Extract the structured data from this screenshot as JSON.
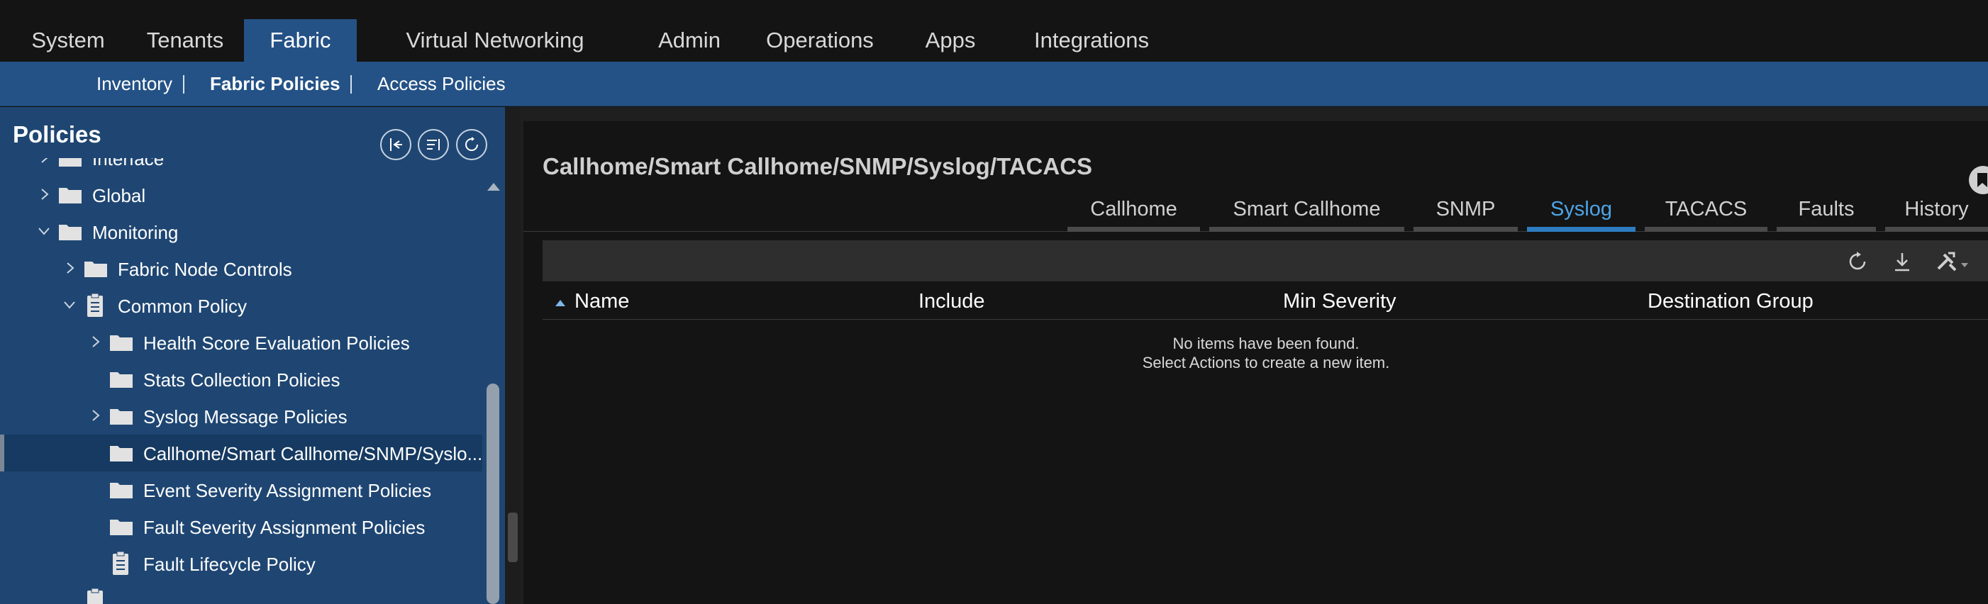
{
  "topnav": {
    "tabs": [
      "System",
      "Tenants",
      "Fabric",
      "Virtual Networking",
      "Admin",
      "Operations",
      "Apps",
      "Integrations"
    ],
    "active": "Fabric"
  },
  "subnav": {
    "items": [
      "Inventory",
      "Fabric Policies",
      "Access Policies"
    ],
    "active": "Fabric Policies"
  },
  "sidebar": {
    "title": "Policies",
    "tree": [
      {
        "label": "Interface",
        "icon": "folder-icon",
        "chevron": "right"
      },
      {
        "label": "Global",
        "icon": "folder-icon",
        "chevron": "right"
      },
      {
        "label": "Monitoring",
        "icon": "folder-icon",
        "chevron": "down"
      },
      {
        "label": "Fabric Node Controls",
        "icon": "folder-icon",
        "chevron": "right"
      },
      {
        "label": "Common Policy",
        "icon": "document-icon",
        "chevron": "down"
      },
      {
        "label": "Health Score Evaluation Policies",
        "icon": "folder-icon",
        "chevron": "right"
      },
      {
        "label": "Stats Collection Policies",
        "icon": "folder-icon",
        "chevron": "none"
      },
      {
        "label": "Syslog Message Policies",
        "icon": "folder-icon",
        "chevron": "right"
      },
      {
        "label": "Callhome/Smart Callhome/SNMP/Syslo...",
        "icon": "folder-icon",
        "chevron": "none",
        "selected": true
      },
      {
        "label": "Event Severity Assignment Policies",
        "icon": "folder-icon",
        "chevron": "none"
      },
      {
        "label": "Fault Severity Assignment Policies",
        "icon": "folder-icon",
        "chevron": "none"
      },
      {
        "label": "Fault Lifecycle Policy",
        "icon": "document-icon",
        "chevron": "none"
      }
    ]
  },
  "main": {
    "title": "Callhome/Smart Callhome/SNMP/Syslog/TACACS",
    "tabs": [
      "Callhome",
      "Smart Callhome",
      "SNMP",
      "Syslog",
      "TACACS",
      "Faults",
      "History"
    ],
    "active_tab": "Syslog",
    "table": {
      "columns": [
        "Name",
        "Include",
        "Min Severity",
        "Destination Group"
      ],
      "sort_column": "Name",
      "sort_direction": "ascending"
    },
    "empty_line1": "No items have been found.",
    "empty_line2": "Select Actions to create a new item."
  },
  "colors": {
    "accent": "#245286",
    "sidebar": "#1f4672",
    "active_tab": "#4ea4e6"
  }
}
